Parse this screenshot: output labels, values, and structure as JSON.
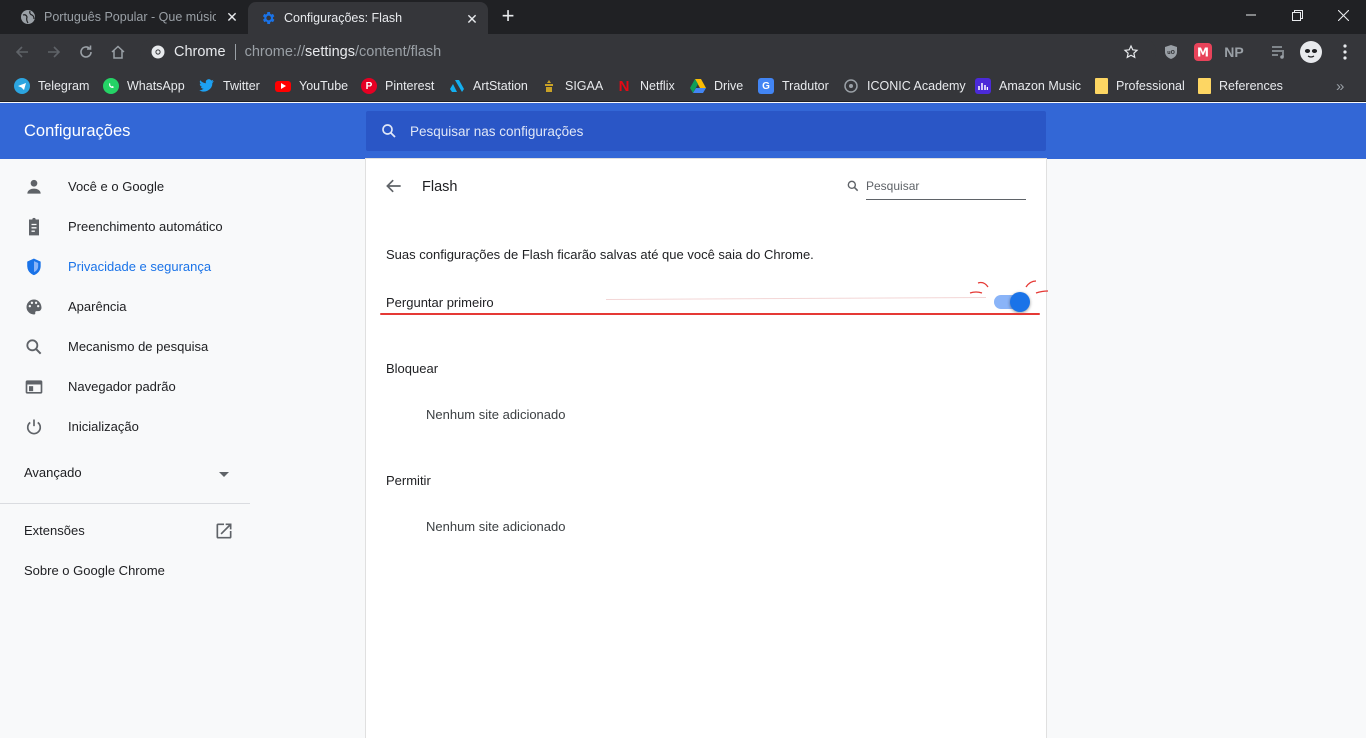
{
  "tabs": [
    {
      "title": "Português Popular - Que música",
      "active": false,
      "close": "✕"
    },
    {
      "title": "Configurações: Flash",
      "active": true,
      "close": "✕"
    }
  ],
  "newtab": "+",
  "omnibox": {
    "chip_label": "Chrome",
    "url_scheme": "chrome://",
    "url_host": "settings",
    "url_path": "/content/flash"
  },
  "extensions": [
    "ublock-icon",
    "m-icon",
    "np-icon",
    "queue-icon",
    "profile-avatar"
  ],
  "np_label": "NP",
  "bookmarks": [
    {
      "label": "Telegram",
      "color": "#2ca5e0"
    },
    {
      "label": "WhatsApp",
      "color": "#25d366"
    },
    {
      "label": "Twitter",
      "color": "#1da1f2"
    },
    {
      "label": "YouTube",
      "color": "#ff0000"
    },
    {
      "label": "Pinterest",
      "color": "#e60023"
    },
    {
      "label": "ArtStation",
      "color": "#13aff0"
    },
    {
      "label": "SIGAA",
      "color": "#c9a227"
    },
    {
      "label": "Netflix",
      "color": "#e50914"
    },
    {
      "label": "Drive",
      "color": "#fbbc04"
    },
    {
      "label": "Tradutor",
      "color": "#4285f4"
    },
    {
      "label": "ICONIC Academy",
      "color": "#9aa0a6"
    },
    {
      "label": "Amazon Music",
      "color": "#4b2ad8"
    },
    {
      "label": "Professional",
      "color": "#fdd663"
    },
    {
      "label": "References",
      "color": "#fdd663"
    }
  ],
  "bookmarks_overflow": "»",
  "settings": {
    "title": "Configurações",
    "search_placeholder": "Pesquisar nas configurações"
  },
  "sidebar": {
    "items": [
      {
        "label": "Você e o Google",
        "icon": "person-icon"
      },
      {
        "label": "Preenchimento automático",
        "icon": "clipboard-icon"
      },
      {
        "label": "Privacidade e segurança",
        "icon": "shield-icon",
        "selected": true
      },
      {
        "label": "Aparência",
        "icon": "palette-icon"
      },
      {
        "label": "Mecanismo de pesquisa",
        "icon": "search-icon"
      },
      {
        "label": "Navegador padrão",
        "icon": "browser-icon"
      },
      {
        "label": "Inicialização",
        "icon": "power-icon"
      }
    ],
    "advanced": "Avançado",
    "extensions": "Extensões",
    "about": "Sobre o Google Chrome"
  },
  "page": {
    "title": "Flash",
    "search_placeholder": "Pesquisar",
    "info": "Suas configurações de Flash ficarão salvas até que você saia do Chrome.",
    "ask_first": "Perguntar primeiro",
    "ask_first_enabled": true,
    "block_title": "Bloquear",
    "block_empty": "Nenhum site adicionado",
    "allow_title": "Permitir",
    "allow_empty": "Nenhum site adicionado"
  },
  "colors": {
    "accent": "#1a73e8",
    "header": "#3367d6",
    "annotation": "#e53935"
  }
}
